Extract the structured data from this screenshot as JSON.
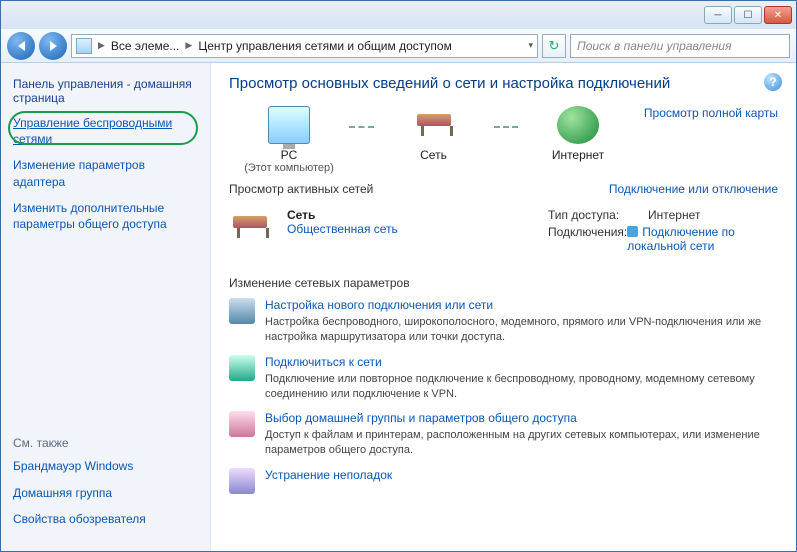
{
  "titlebar": {
    "min": "─",
    "max": "☐",
    "close": "✕"
  },
  "nav": {
    "crumb1": "Все элеме...",
    "crumb2": "Центр управления сетями и общим доступом",
    "search_placeholder": "Поиск в панели управления"
  },
  "sidebar": {
    "home": "Панель управления - домашняя страница",
    "links": [
      "Управление беспроводными сетями",
      "Изменение параметров адаптера",
      "Изменить дополнительные параметры общего доступа"
    ],
    "seealso_label": "См. также",
    "seealso": [
      "Брандмауэр Windows",
      "Домашняя группа",
      "Свойства обозревателя"
    ]
  },
  "main": {
    "heading": "Просмотр основных сведений о сети и настройка подключений",
    "diagram": {
      "pc_label": "PC",
      "pc_sub": "(Этот компьютер)",
      "net_label": "Сеть",
      "inet_label": "Интернет",
      "maplink": "Просмотр полной карты"
    },
    "active": {
      "section": "Просмотр активных сетей",
      "conlink": "Подключение или отключение",
      "netname": "Сеть",
      "nettype_link": "Общественная сеть",
      "access_k": "Тип доступа:",
      "access_v": "Интернет",
      "conn_k": "Подключения:",
      "conn_v": "Подключение по локальной сети"
    },
    "changes": {
      "heading": "Изменение сетевых параметров",
      "tasks": [
        {
          "t": "Настройка нового подключения или сети",
          "d": "Настройка беспроводного, широкополосного, модемного, прямого или VPN-подключения или же настройка маршрутизатора или точки доступа."
        },
        {
          "t": "Подключиться к сети",
          "d": "Подключение или повторное подключение к беспроводному, проводному, модемному сетевому соединению или подключение к VPN."
        },
        {
          "t": "Выбор домашней группы и параметров общего доступа",
          "d": "Доступ к файлам и принтерам, расположенным на других сетевых компьютерах, или изменение параметров общего доступа."
        },
        {
          "t": "Устранение неполадок",
          "d": ""
        }
      ]
    }
  }
}
